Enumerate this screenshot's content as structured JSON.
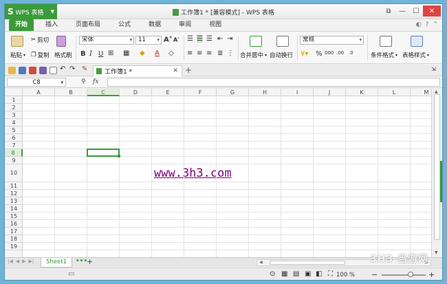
{
  "titlebar": {
    "app_button": "WPS 表格",
    "app_logo": "S",
    "title": "工作簿1 * [兼容模式] - WPS 表格",
    "controls": [
      "restore-window",
      "minimize",
      "maximize",
      "close"
    ]
  },
  "tabs": [
    "开始",
    "插入",
    "页面布局",
    "公式",
    "数据",
    "审阅",
    "视图"
  ],
  "ribbon": {
    "paste": "粘贴",
    "cut": "剪切",
    "copy": "复制",
    "format_painter": "格式刷",
    "font_name": "宋体",
    "font_size": "11",
    "bold": "B",
    "italic": "I",
    "underline": "U",
    "merge_center": "合并居中",
    "wrap_text": "自动换行",
    "number_format": "常规",
    "percent": "%",
    "conditional_format": "条件格式",
    "table_style": "表格样式"
  },
  "document": {
    "tab_title": "工作簿1 *",
    "name_box": "C8",
    "fx": "fx"
  },
  "grid": {
    "columns": [
      "A",
      "B",
      "C",
      "D",
      "E",
      "F",
      "G",
      "H",
      "I",
      "J",
      "K",
      "L",
      "M"
    ],
    "rows": [
      "1",
      "2",
      "3",
      "4",
      "5",
      "6",
      "7",
      "8",
      "9",
      "10",
      "11",
      "12",
      "13",
      "14",
      "15",
      "16",
      "17",
      "18",
      "19"
    ],
    "selected_column": "C",
    "selected_row": "8",
    "watermark_text": "www.3h3.com"
  },
  "sheets": {
    "active": "Sheet1",
    "more": "•••",
    "add": "+"
  },
  "status": {
    "zoom": "100 %",
    "zoom_minus": "−",
    "zoom_plus": "+",
    "zoom_fraction": 0.66
  },
  "brand_watermark": "3H3 当游网",
  "colors": {
    "accent": "#3b9b39",
    "close": "#e04343",
    "watermark": "#800080"
  }
}
